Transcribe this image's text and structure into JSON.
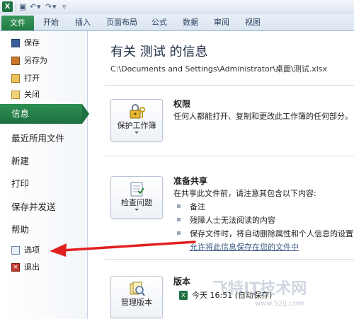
{
  "quick_access": {
    "app_icon": "excel-icon",
    "icons": [
      "save-icon",
      "undo-icon",
      "redo-icon",
      "customize-dropdown-icon"
    ]
  },
  "ribbon": {
    "file_tab": "文件",
    "tabs": [
      "开始",
      "插入",
      "页面布局",
      "公式",
      "数据",
      "审阅",
      "视图"
    ]
  },
  "nav": {
    "small_items": [
      {
        "label": "保存",
        "icon": "save-icon"
      },
      {
        "label": "另存为",
        "icon": "save-as-icon"
      },
      {
        "label": "打开",
        "icon": "open-folder-icon"
      },
      {
        "label": "关闭",
        "icon": "close-folder-icon"
      }
    ],
    "active_item": "信息",
    "big_items": [
      "最近所用文件",
      "新建",
      "打印",
      "保存并发送",
      "帮助"
    ],
    "bottom_items": [
      {
        "label": "选项",
        "icon": "options-icon"
      },
      {
        "label": "退出",
        "icon": "exit-icon"
      }
    ]
  },
  "main": {
    "title": "有关 测试 的信息",
    "path": "C:\\Documents and Settings\\Administrator\\桌面\\测试.xlsx",
    "permissions": {
      "button": "保护工作簿",
      "icon": "lock-key-icon",
      "title": "权限",
      "description": "任何人都能打开、复制和更改此工作簿的任何部分。"
    },
    "share": {
      "button": "检查问题",
      "icon": "check-document-icon",
      "title": "准备共享",
      "description": "在共享此文件前，请注意其包含以下内容:",
      "bullets": [
        "备注",
        "残障人士无法阅读的内容",
        "保存文件时，将自动删除属性和个人信息的设置"
      ],
      "link": "允许将此信息保存在您的文件中"
    },
    "versions": {
      "button": "管理版本",
      "icon": "versions-icon",
      "title": "版本",
      "entry": "今天 16:51 (自动保存)"
    }
  },
  "annotation": {
    "arrow_color": "#e02020"
  },
  "watermark": {
    "text": "飞特IT技术网",
    "url": "www.52ij.com"
  },
  "colors": {
    "accent_green": "#217a43",
    "title_text": "#1e2d44"
  }
}
